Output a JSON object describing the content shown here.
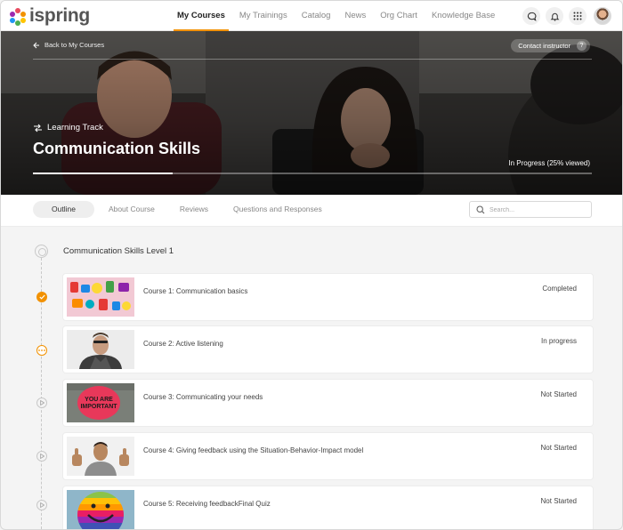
{
  "nav": {
    "logo": "ispring",
    "links": [
      "My Courses",
      "My Trainings",
      "Catalog",
      "News",
      "Org Chart",
      "Knowledge Base"
    ],
    "active_link": "My Courses"
  },
  "hero": {
    "back_label": "Back to My Courses",
    "contact_label": "Contact instructor",
    "contact_help": "?",
    "track_label": "Learning Track",
    "title": "Communication Skills",
    "progress_text": "In Progress (25% viewed)",
    "progress_fraction": 0.25
  },
  "tabs": [
    "Outline",
    "About Course",
    "Reviews",
    "Questions and Responses"
  ],
  "search": {
    "placeholder": "Search..."
  },
  "outline": {
    "level_title": "Communication Skills Level 1",
    "courses": [
      {
        "name": "Course 1: Communication basics",
        "status": "Completed",
        "state": "done",
        "thumb": "letters-icon"
      },
      {
        "name": "Course 2: Active listening",
        "status": "In progress",
        "state": "progress",
        "thumb": "listening-man-icon"
      },
      {
        "name": "Course 3: Communicating your needs",
        "status": "Not Started",
        "state": "pending",
        "thumb": "sign-icon",
        "thumb_text": [
          "YOU ARE",
          "IMPORTANT"
        ]
      },
      {
        "name": "Course 4: Giving feedback using the Situation-Behavior-Impact model",
        "status": "Not Started",
        "state": "pending",
        "thumb": "thumbs-up-man-icon"
      },
      {
        "name": "Course 5: Receiving feedbackFinal Quiz",
        "status": "Not Started",
        "state": "pending",
        "thumb": "smiley-icon"
      }
    ]
  },
  "colors": {
    "accent": "#f29100"
  }
}
